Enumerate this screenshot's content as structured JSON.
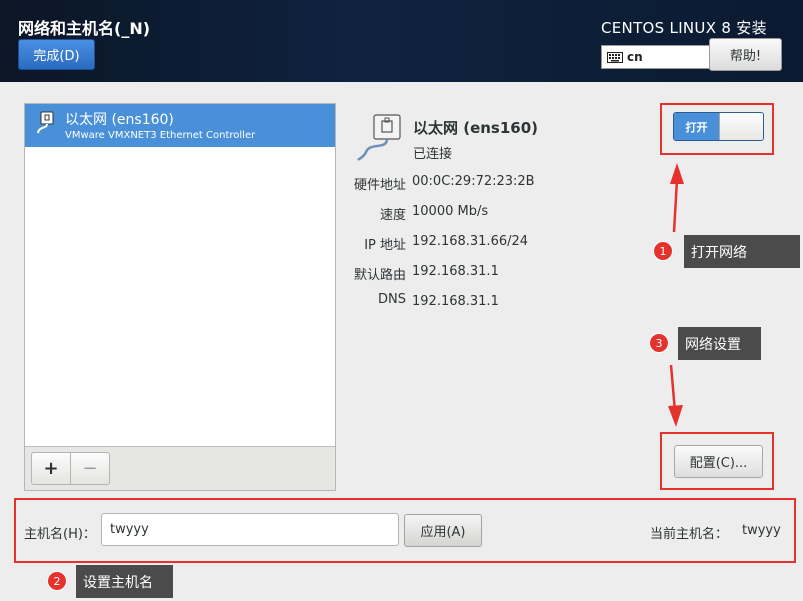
{
  "header": {
    "title": "网络和主机名(_N)",
    "done_label": "完成(D)",
    "product": "CENTOS LINUX 8 安装",
    "keyboard_layout": "cn",
    "help_label": "帮助!"
  },
  "device_list": {
    "items": [
      {
        "name": "以太网 (ens160)",
        "description": "VMware VMXNET3 Ethernet Controller",
        "icon": "ethernet-icon"
      }
    ],
    "add_label": "+",
    "remove_label": "−"
  },
  "device_detail": {
    "name": "以太网 (ens160)",
    "status": "已连接",
    "properties": [
      {
        "label": "硬件地址",
        "value": "00:0C:29:72:23:2B"
      },
      {
        "label": "速度",
        "value": "10000 Mb/s"
      },
      {
        "label": "IP 地址",
        "value": "192.168.31.66/24"
      },
      {
        "label": "默认路由",
        "value": "192.168.31.1"
      },
      {
        "label": "DNS",
        "value": "192.168.31.1"
      }
    ],
    "switch_label": "打开",
    "switch_on": true,
    "configure_label": "配置(C)..."
  },
  "hostname": {
    "label": "主机名(H)：",
    "value": "twyyy",
    "apply_label": "应用(A)",
    "current_label": "当前主机名：",
    "current_value": "twyyy"
  },
  "annotations": [
    {
      "number": "1",
      "text": "打开网络"
    },
    {
      "number": "2",
      "text": "设置主机名"
    },
    {
      "number": "3",
      "text": "网络设置"
    }
  ],
  "colors": {
    "accent": "#4a90d9",
    "annotation_red": "#e5322d",
    "callout_bg": "#4b4b4b",
    "header_bg": "#0f2240"
  }
}
